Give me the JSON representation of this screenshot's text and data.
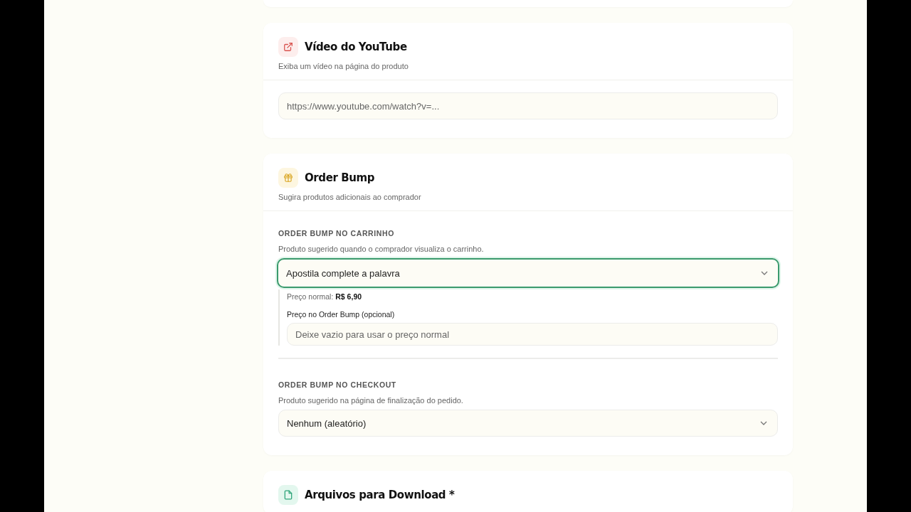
{
  "sections": [
    {
      "kind": "link",
      "title": "Vídeo do YouTube",
      "description": "Exiba um vídeo na página do produto",
      "fields": [
        {
          "kind": "input",
          "placeholder": "https://www.youtube.com/watch?v=..."
        }
      ]
    },
    {
      "kind": "gift",
      "title": "Order Bump",
      "description": "Sugira produtos adicionais ao comprador",
      "fields": [
        {
          "kind": "select",
          "label": "ORDER BUMP NO CARRINHO",
          "hint": "Produto sugerido quando o comprador visualiza o carrinho.",
          "value": "Apostila complete a palavra",
          "focused": true,
          "details": {
            "price_text": "Preço normal: **R$ 6,90**",
            "price_label": "Preço no Order Bump (opcional)",
            "placeholder": "Deixe vazio para usar o preço normal"
          }
        },
        {
          "kind": "select",
          "label": "ORDER BUMP NO CHECKOUT",
          "hint": "Produto sugerido na página de finalização do pedido.",
          "value": "Nenhum (aleatório)",
          "focused": false
        }
      ]
    },
    {
      "kind": "file",
      "title": "Arquivos para Download *"
    }
  ]
}
